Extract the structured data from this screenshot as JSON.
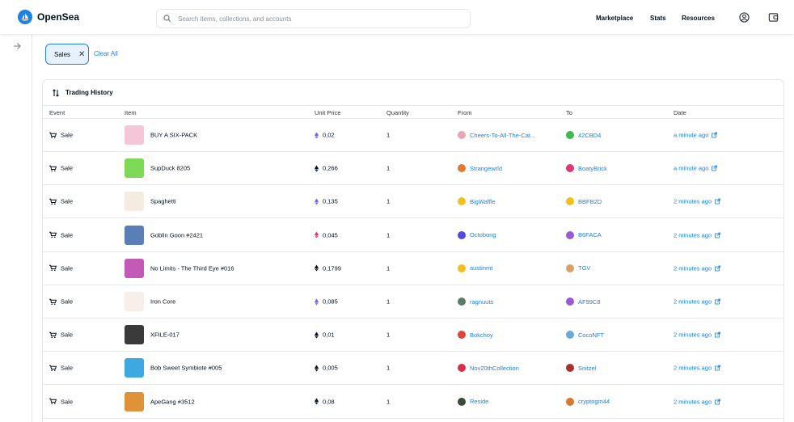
{
  "header": {
    "brand": "OpenSea",
    "search_placeholder": "Search items, collections, and accounts",
    "nav": [
      "Marketplace",
      "Stats",
      "Resources"
    ]
  },
  "filters": {
    "active_chip": "Sales",
    "clear_all": "Clear All"
  },
  "panel": {
    "title": "Trading History",
    "columns": [
      "Event",
      "Item",
      "Unit Price",
      "Quantity",
      "From",
      "To",
      "Date"
    ]
  },
  "colors": {
    "accent": "#2081e2",
    "border": "#e5e8eb",
    "text": "#04111d"
  },
  "rows": [
    {
      "event": "Sale",
      "item": "BUY A SIX-PACK",
      "thumb": "#f4c6d8",
      "price": "0,02",
      "eth": "#7b5cf5",
      "qty": "1",
      "from": "Cheers-To-All-The-Cat...",
      "from_color": "#e8a6b4",
      "to": "42CBD4",
      "to_color": "#3fb950",
      "date": "a minute ago"
    },
    {
      "event": "Sale",
      "item": "SupDuck 8205",
      "thumb": "#7ed957",
      "price": "0,266",
      "eth": "#04111d",
      "qty": "1",
      "from": "Strangewrld",
      "from_color": "#e07a2f",
      "to": "BoatyBrick",
      "to_color": "#e0357a",
      "date": "a minute ago"
    },
    {
      "event": "Sale",
      "item": "Spaghetti",
      "thumb": "#f3ede0",
      "price": "0,135",
      "eth": "#7b5cf5",
      "qty": "1",
      "from": "BigWaffle",
      "from_color": "#f2c01b",
      "to": "BBFB2D",
      "to_color": "#f2c01b",
      "date": "2 minutes ago"
    },
    {
      "event": "Sale",
      "item": "Goblin Goon #2421",
      "thumb": "#5a7fb8",
      "price": "0,045",
      "eth": "#e0357a",
      "qty": "1",
      "from": "Octobong",
      "from_color": "#4d4de0",
      "to": "B6FACA",
      "to_color": "#9b59d6",
      "date": "2 minutes ago"
    },
    {
      "event": "Sale",
      "item": "No Limits - The Third Eye #016",
      "thumb": "#c45ab8",
      "price": "0,1799",
      "eth": "#04111d",
      "qty": "1",
      "from": "austinmt",
      "from_color": "#f2c01b",
      "to": "TGV",
      "to_color": "#d9a066",
      "date": "2 minutes ago"
    },
    {
      "event": "Sale",
      "item": "Iron Core",
      "thumb": "#f6f0e8",
      "price": "0,085",
      "eth": "#7b5cf5",
      "qty": "1",
      "from": "ragnuuts",
      "from_color": "#5c7a6a",
      "to": "AF99C8",
      "to_color": "#9b59d6",
      "date": "2 minutes ago"
    },
    {
      "event": "Sale",
      "item": "XFILE-017",
      "thumb": "#3a3a3a",
      "price": "0,01",
      "eth": "#04111d",
      "qty": "1",
      "from": "Bokchoy",
      "from_color": "#e0443a",
      "to": "CocoNFT",
      "to_color": "#6aa9d9",
      "date": "2 minutes ago"
    },
    {
      "event": "Sale",
      "item": "Bob Sweet Symbiote #005",
      "thumb": "#3da9e0",
      "price": "0,005",
      "eth": "#04111d",
      "qty": "1",
      "from": "Nov20thCollection",
      "from_color": "#d6304b",
      "to": "Snitzel",
      "to_color": "#a83232",
      "date": "2 minutes ago"
    },
    {
      "event": "Sale",
      "item": "ApeGang #3512",
      "thumb": "#e0923a",
      "price": "0,08",
      "eth": "#04111d",
      "qty": "1",
      "from": "Reside",
      "from_color": "#3a4a3a",
      "to": "cryptogm44",
      "to_color": "#d97a2b",
      "date": "2 minutes ago"
    }
  ]
}
